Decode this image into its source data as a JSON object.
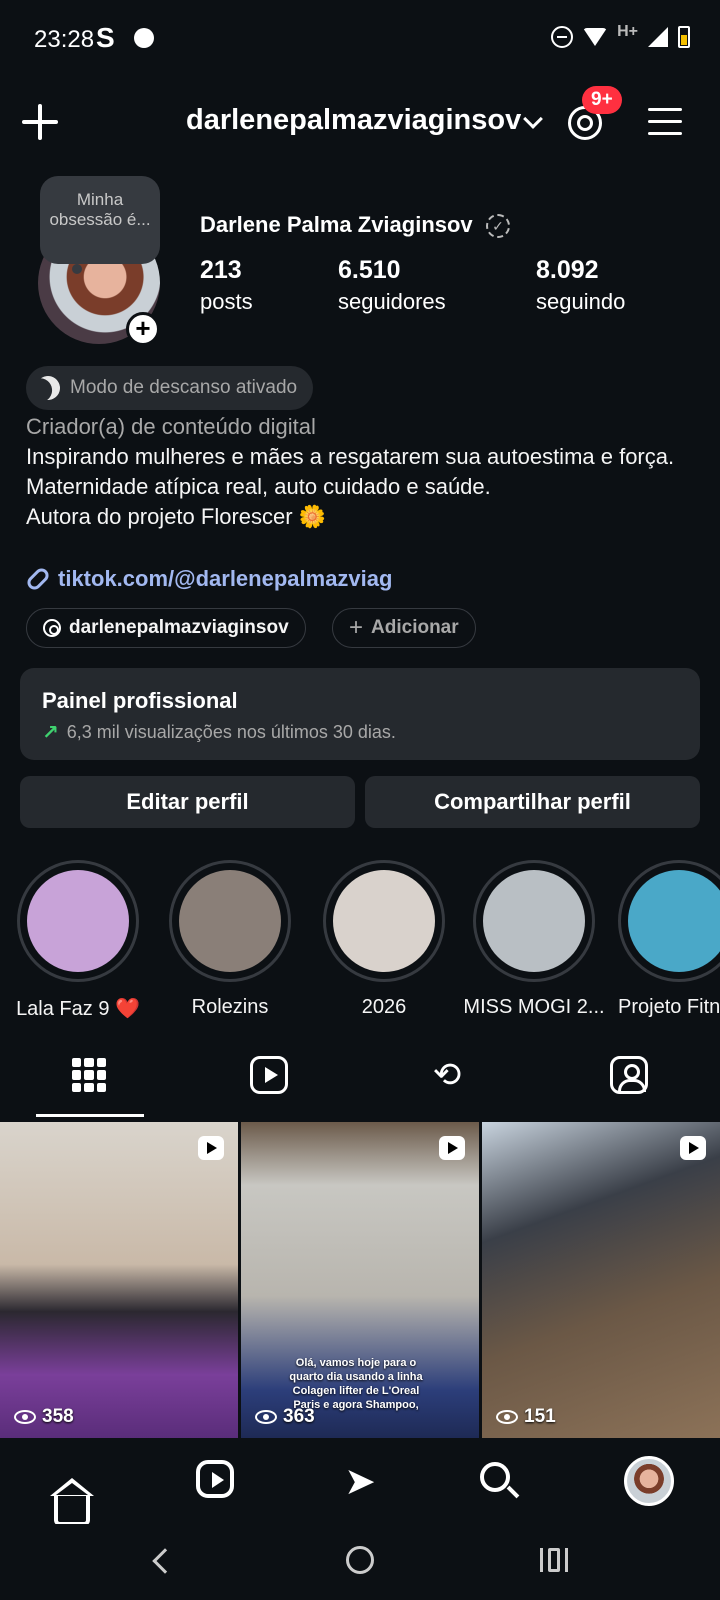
{
  "status_bar": {
    "time": "23:28",
    "app_letter": "S",
    "network": "H+"
  },
  "header": {
    "username": "darlenepalmazviaginsov",
    "notification_badge": "9+"
  },
  "profile": {
    "note": "Minha obsessão é...",
    "display_name": "Darlene Palma Zviaginsov",
    "stats": [
      {
        "value": "213",
        "label": "posts"
      },
      {
        "value": "6.510",
        "label": "seguidores"
      },
      {
        "value": "8.092",
        "label": "seguindo"
      }
    ],
    "rest_mode": "Modo de descanso ativado",
    "category": "Criador(a) de conteúdo digital",
    "bio_lines": [
      "Inspirando mulheres e mães a resgatarem sua autoestima e força.",
      "Maternidade atípica real, auto cuidado e saúde.",
      "Autora do projeto Florescer 🌼"
    ],
    "link": "tiktok.com/@darlenepalmazviag",
    "threads_chip": "darlenepalmazviaginsov",
    "add_chip": "Adicionar"
  },
  "pro_panel": {
    "title": "Painel profissional",
    "subtitle": "6,3 mil visualizações nos últimos 30 dias."
  },
  "buttons": {
    "edit": "Editar perfil",
    "share": "Compartilhar perfil"
  },
  "highlights": [
    {
      "label": "Lala Faz 9 ❤️",
      "color": "#c8a3d8"
    },
    {
      "label": "Rolezins",
      "color": "#8a7f78"
    },
    {
      "label": "2026",
      "color": "#d9d2cc"
    },
    {
      "label": "MISS MOGI 2...",
      "color": "#b9bfc4"
    },
    {
      "label": "Projeto Fitn",
      "color": "#4aa8c8"
    }
  ],
  "posts": [
    {
      "views": "358",
      "caption": ""
    },
    {
      "views": "363",
      "caption": "Olá, vamos hoje para o quarto dia usando a linha Colagen lifter de L'Oreal Paris e agora Shampoo,"
    },
    {
      "views": "151",
      "caption": ""
    }
  ]
}
